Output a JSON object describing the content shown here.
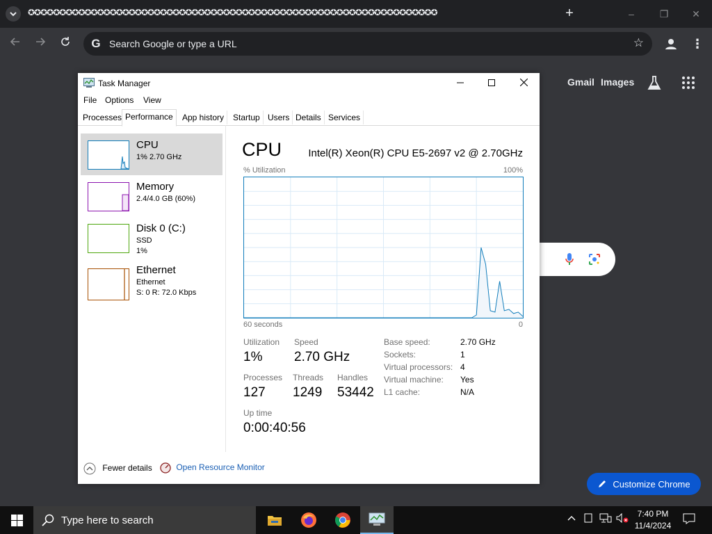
{
  "browser": {
    "tab_title": "✪✪✪✪✪✪✪✪✪✪✪✪✪✪✪✪✪✪✪✪✪✪✪✪✪✪✪✪✪✪✪✪✪✪✪✪✪✪✪✪✪✪✪✪✪✪✪✪✪✪✪✪✪✪✪✪✪✪✪✪✪✪✪✪✪",
    "new_tab": "+",
    "omnibox_placeholder": "Search Google or type a URL",
    "window_controls": {
      "minimize": "–",
      "restore": "❐",
      "close": "✕"
    }
  },
  "ntp": {
    "links": [
      "Gmail",
      "Images"
    ],
    "customize_label": "Customize Chrome"
  },
  "task_manager": {
    "title": "Task Manager",
    "menu": [
      "File",
      "Options",
      "View"
    ],
    "tabs": [
      "Processes",
      "Performance",
      "App history",
      "Startup",
      "Users",
      "Details",
      "Services"
    ],
    "active_tab": "Performance",
    "resources": [
      {
        "name": "CPU",
        "line1": "1%  2.70 GHz",
        "line2": "",
        "color": "#117dbb"
      },
      {
        "name": "Memory",
        "line1": "2.4/4.0 GB (60%)",
        "line2": "",
        "color": "#8b12ae"
      },
      {
        "name": "Disk 0 (C:)",
        "line1": "SSD",
        "line2": "1%",
        "color": "#4da60c"
      },
      {
        "name": "Ethernet",
        "line1": "Ethernet",
        "line2": "S: 0  R: 72.0 Kbps",
        "color": "#a74f01"
      }
    ],
    "cpu": {
      "title": "CPU",
      "model": "Intel(R) Xeon(R) CPU E5-2697 v2 @ 2.70GHz",
      "util_label": "% Utilization",
      "max_label": "100%",
      "time_label": "60 seconds",
      "min_label": "0",
      "utilization_label": "Utilization",
      "utilization_value": "1%",
      "speed_label": "Speed",
      "speed_value": "2.70 GHz",
      "processes_label": "Processes",
      "processes_value": "127",
      "threads_label": "Threads",
      "threads_value": "1249",
      "handles_label": "Handles",
      "handles_value": "53442",
      "uptime_label": "Up time",
      "uptime_value": "0:00:40:56",
      "specs": [
        {
          "label": "Base speed:",
          "value": "2.70 GHz"
        },
        {
          "label": "Sockets:",
          "value": "1"
        },
        {
          "label": "Virtual processors:",
          "value": "4"
        },
        {
          "label": "Virtual machine:",
          "value": "Yes"
        },
        {
          "label": "L1 cache:",
          "value": "N/A"
        }
      ]
    },
    "fewer_details": "Fewer details",
    "open_resource_monitor": "Open Resource Monitor"
  },
  "taskbar": {
    "search_placeholder": "Type here to search",
    "time": "7:40 PM",
    "date": "11/4/2024"
  },
  "chart_data": {
    "type": "area",
    "title": "CPU",
    "ylabel": "% Utilization",
    "xlabel": "60 seconds",
    "ylim": [
      0,
      100
    ],
    "x": [
      0,
      10,
      20,
      30,
      39,
      40,
      41,
      42,
      43,
      44,
      45,
      46,
      47,
      48,
      49,
      50,
      51,
      52,
      53,
      54,
      55,
      56,
      57,
      58,
      59,
      60
    ],
    "y": [
      0,
      0,
      0,
      0,
      0,
      0,
      0,
      0,
      0,
      0,
      0,
      0,
      0,
      0,
      0,
      2,
      50,
      38,
      5,
      4,
      26,
      5,
      6,
      3,
      4,
      1
    ],
    "grid": true
  }
}
